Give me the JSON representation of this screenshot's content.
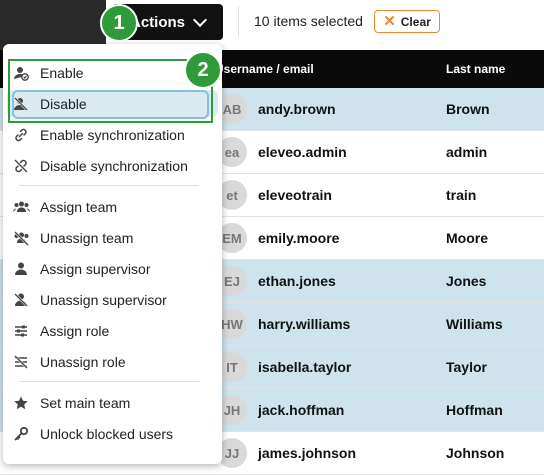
{
  "toolbar": {
    "actions_label": "Actions",
    "selected_text": "10 items selected",
    "clear_label": "Clear"
  },
  "table": {
    "columns": [
      "Username / email",
      "Last name"
    ],
    "rows": [
      {
        "initials": "AB",
        "username": "andy.brown",
        "lastname": "Brown",
        "selected": true
      },
      {
        "initials": "ea",
        "username": "eleveo.admin",
        "lastname": "admin",
        "selected": false
      },
      {
        "initials": "et",
        "username": "eleveotrain",
        "lastname": "train",
        "selected": false
      },
      {
        "initials": "EM",
        "username": "emily.moore",
        "lastname": "Moore",
        "selected": false
      },
      {
        "initials": "EJ",
        "username": "ethan.jones",
        "lastname": "Jones",
        "selected": true
      },
      {
        "initials": "HW",
        "username": "harry.williams",
        "lastname": "Williams",
        "selected": true
      },
      {
        "initials": "IT",
        "username": "isabella.taylor",
        "lastname": "Taylor",
        "selected": true
      },
      {
        "initials": "JH",
        "username": "jack.hoffman",
        "lastname": "Hoffman",
        "selected": true
      },
      {
        "initials": "JJ",
        "username": "james.johnson",
        "lastname": "Johnson",
        "selected": false
      }
    ]
  },
  "menu": {
    "items": [
      {
        "label": "Enable",
        "icon": "user-enable-icon"
      },
      {
        "label": "Disable",
        "icon": "user-disable-icon"
      },
      {
        "label": "Enable synchronization",
        "icon": "link-icon"
      },
      {
        "label": "Disable synchronization",
        "icon": "unlink-icon"
      },
      {
        "label": "Assign team",
        "icon": "team-icon"
      },
      {
        "label": "Unassign team",
        "icon": "team-off-icon"
      },
      {
        "label": "Assign supervisor",
        "icon": "supervisor-icon"
      },
      {
        "label": "Unassign supervisor",
        "icon": "supervisor-off-icon"
      },
      {
        "label": "Assign role",
        "icon": "role-icon"
      },
      {
        "label": "Unassign role",
        "icon": "role-off-icon"
      },
      {
        "label": "Set main team",
        "icon": "star-icon"
      },
      {
        "label": "Unlock blocked users",
        "icon": "key-icon"
      }
    ]
  },
  "callouts": {
    "step1": "1",
    "step2": "2"
  },
  "colors": {
    "selected_row": "#cfe3ec",
    "highlight": "#2e9a3a",
    "clear_accent": "#e8893a"
  }
}
